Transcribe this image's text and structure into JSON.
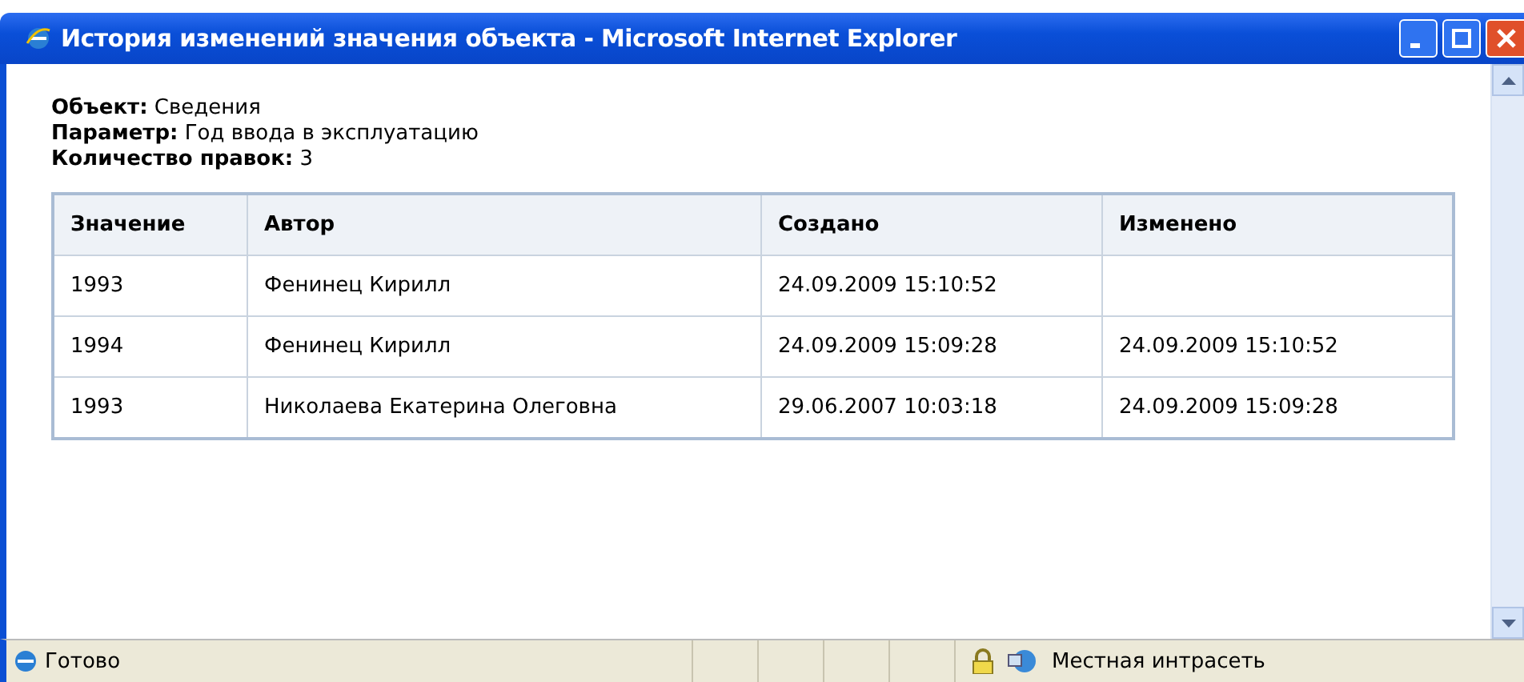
{
  "window": {
    "title": "История изменений значения объекта - Microsoft Internet Explorer"
  },
  "info": [
    {
      "label": "Объект:",
      "value": "Сведения"
    },
    {
      "label": "Параметр:",
      "value": "Год ввода в эксплуатацию"
    },
    {
      "label": "Количество правок:",
      "value": "3"
    }
  ],
  "table": {
    "columns": [
      "Значение",
      "Автор",
      "Создано",
      "Изменено"
    ],
    "rows": [
      [
        "1993",
        "Фенинец Кирилл",
        "24.09.2009 15:10:52",
        ""
      ],
      [
        "1994",
        "Фенинец Кирилл",
        "24.09.2009 15:09:28",
        "24.09.2009 15:10:52"
      ],
      [
        "1993",
        "Николаева Екатерина Олеговна",
        "29.06.2007 10:03:18",
        "24.09.2009 15:09:28"
      ]
    ]
  },
  "status_bar": {
    "status": "Готово",
    "zone": "Местная интрасеть"
  }
}
